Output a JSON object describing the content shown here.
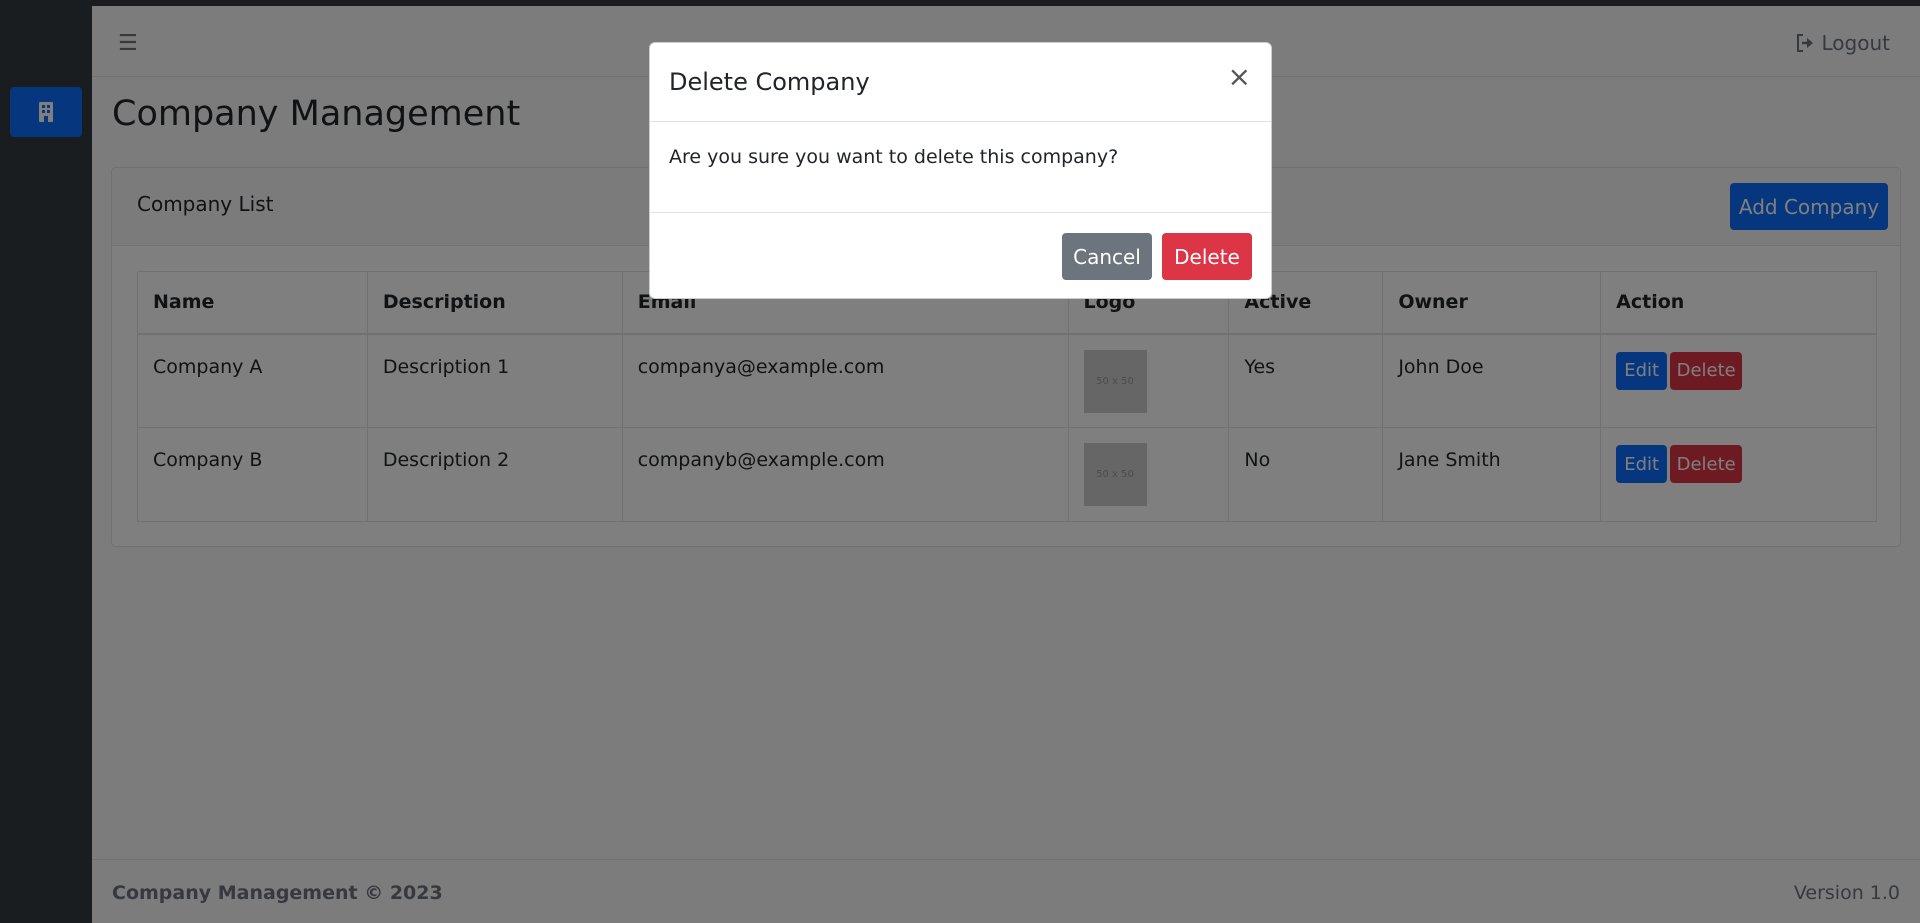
{
  "header": {
    "menu_icon": "hamburger-icon",
    "logout_icon": "sign-out-icon",
    "logout_label": "Logout"
  },
  "sidebar": {
    "items": [
      {
        "icon": "building-icon",
        "active": true
      }
    ]
  },
  "page": {
    "title": "Company Management"
  },
  "card": {
    "title": "Company List",
    "add_button": "Add Company"
  },
  "table": {
    "columns": [
      "Name",
      "Description",
      "Email",
      "Logo",
      "Active",
      "Owner",
      "Action"
    ],
    "rows": [
      {
        "name": "Company A",
        "description": "Description 1",
        "email": "companya@example.com",
        "logo_placeholder": "50 x 50",
        "active": "Yes",
        "owner": "John Doe",
        "edit_label": "Edit",
        "delete_label": "Delete"
      },
      {
        "name": "Company B",
        "description": "Description 2",
        "email": "companyb@example.com",
        "logo_placeholder": "50 x 50",
        "active": "No",
        "owner": "Jane Smith",
        "edit_label": "Edit",
        "delete_label": "Delete"
      }
    ]
  },
  "footer": {
    "left": "Company Management © 2023",
    "right": "Version 1.0"
  },
  "modal": {
    "title": "Delete Company",
    "close": "×",
    "message": "Are you sure you want to delete this company?",
    "cancel_label": "Cancel",
    "delete_label": "Delete"
  },
  "colors": {
    "primary": "#0d6efd",
    "danger": "#dc3545",
    "secondary": "#6c757d",
    "sidebar": "#343a40"
  }
}
